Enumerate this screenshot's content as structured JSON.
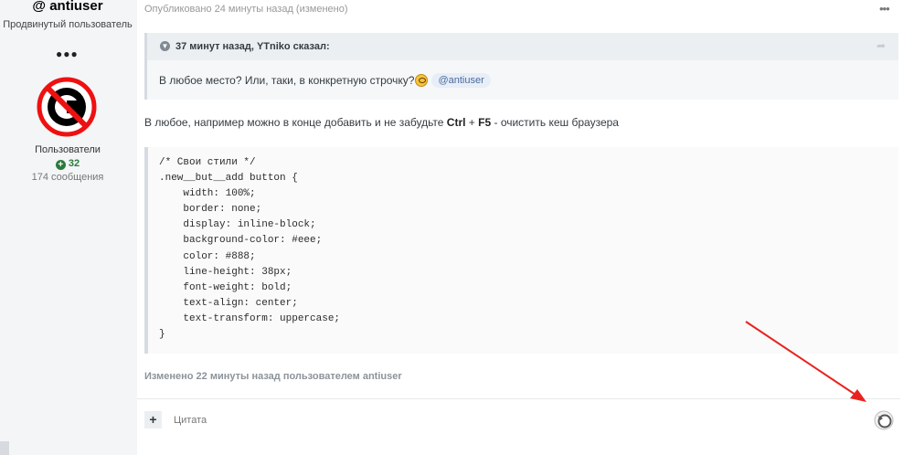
{
  "author": {
    "username": "@ antiuser",
    "rank": "Продвинутый пользователь",
    "rank_dots": "●●●",
    "reputation_label": "Пользователи",
    "reputation_value": "32",
    "posts": "174 сообщения"
  },
  "post": {
    "meta": "Опубликовано 24 минуты назад (изменено)",
    "menu": "•••",
    "quote": {
      "header": "37 минут назад, YTniko сказал:",
      "text": "В любое место? Или, таки, в конкретную строчку?",
      "mention": "@antiuser"
    },
    "text_before": "В любое, например можно в конце добавить и не забудьте ",
    "key1": "Ctrl",
    "plus": " + ",
    "key2": "F5",
    "text_after": " - очистить кеш браузера",
    "code": "/* Свои стили */\n.new__but__add button {\n    width: 100%;\n    border: none;\n    display: inline-block;\n    background-color: #eee;\n    color: #888;\n    line-height: 38px;\n    font-weight: bold;\n    text-align: center;\n    text-transform: uppercase;\n}",
    "edited": "Изменено 22 минуты назад пользователем antiuser"
  },
  "footer": {
    "add": "+",
    "quote_label": "Цитата"
  },
  "colors": {
    "reputation": "#2b7a3d",
    "arrow": "#e8231f"
  }
}
